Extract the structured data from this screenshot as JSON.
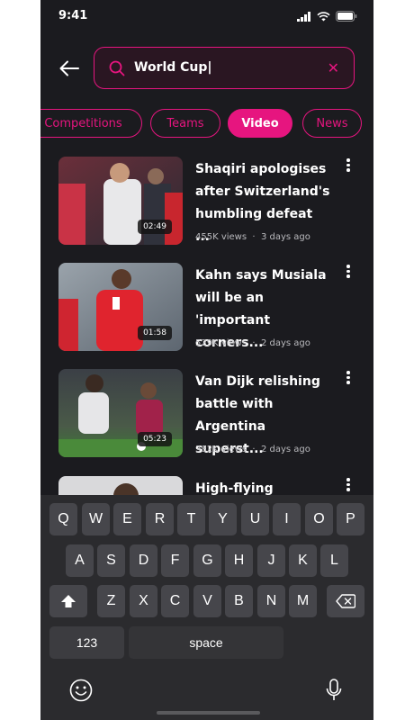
{
  "status": {
    "time": "9:41"
  },
  "search": {
    "query": "World Cup|"
  },
  "chips": [
    {
      "label": "Competitions",
      "active": false
    },
    {
      "label": "Teams",
      "active": false
    },
    {
      "label": "Video",
      "active": true
    },
    {
      "label": "News",
      "active": false
    }
  ],
  "videos": [
    {
      "title": "Shaqiri apologises after Switzerland's humbling defeat ...",
      "duration": "02:49",
      "views": "455K views",
      "age": "3 days ago"
    },
    {
      "title": "Kahn says Musiala will be an 'important corners...",
      "duration": "01:58",
      "views": "529K views",
      "age": "2 days ago"
    },
    {
      "title": "Van Dijk relishing battle with Argentina superst...",
      "duration": "05:23",
      "views": "382K views",
      "age": "2 days ago"
    },
    {
      "title": "High-flying",
      "duration": "",
      "views": "",
      "age": ""
    }
  ],
  "keyboard": {
    "row1": [
      "Q",
      "W",
      "E",
      "R",
      "T",
      "Y",
      "U",
      "I",
      "O",
      "P"
    ],
    "row2": [
      "A",
      "S",
      "D",
      "F",
      "G",
      "H",
      "J",
      "K",
      "L"
    ],
    "row3": [
      "Z",
      "X",
      "C",
      "V",
      "B",
      "N",
      "M"
    ],
    "numbers_label": "123",
    "space_label": "space"
  },
  "icons": [
    "back-arrow-icon",
    "search-icon",
    "clear-icon",
    "more-vertical-icon",
    "shift-icon",
    "backspace-icon",
    "emoji-icon",
    "microphone-icon",
    "signal-icon",
    "wifi-icon",
    "battery-icon"
  ],
  "colors": {
    "accent": "#e6157f",
    "background": "#1b1b1f",
    "keyboard": "#2b2b2e"
  }
}
